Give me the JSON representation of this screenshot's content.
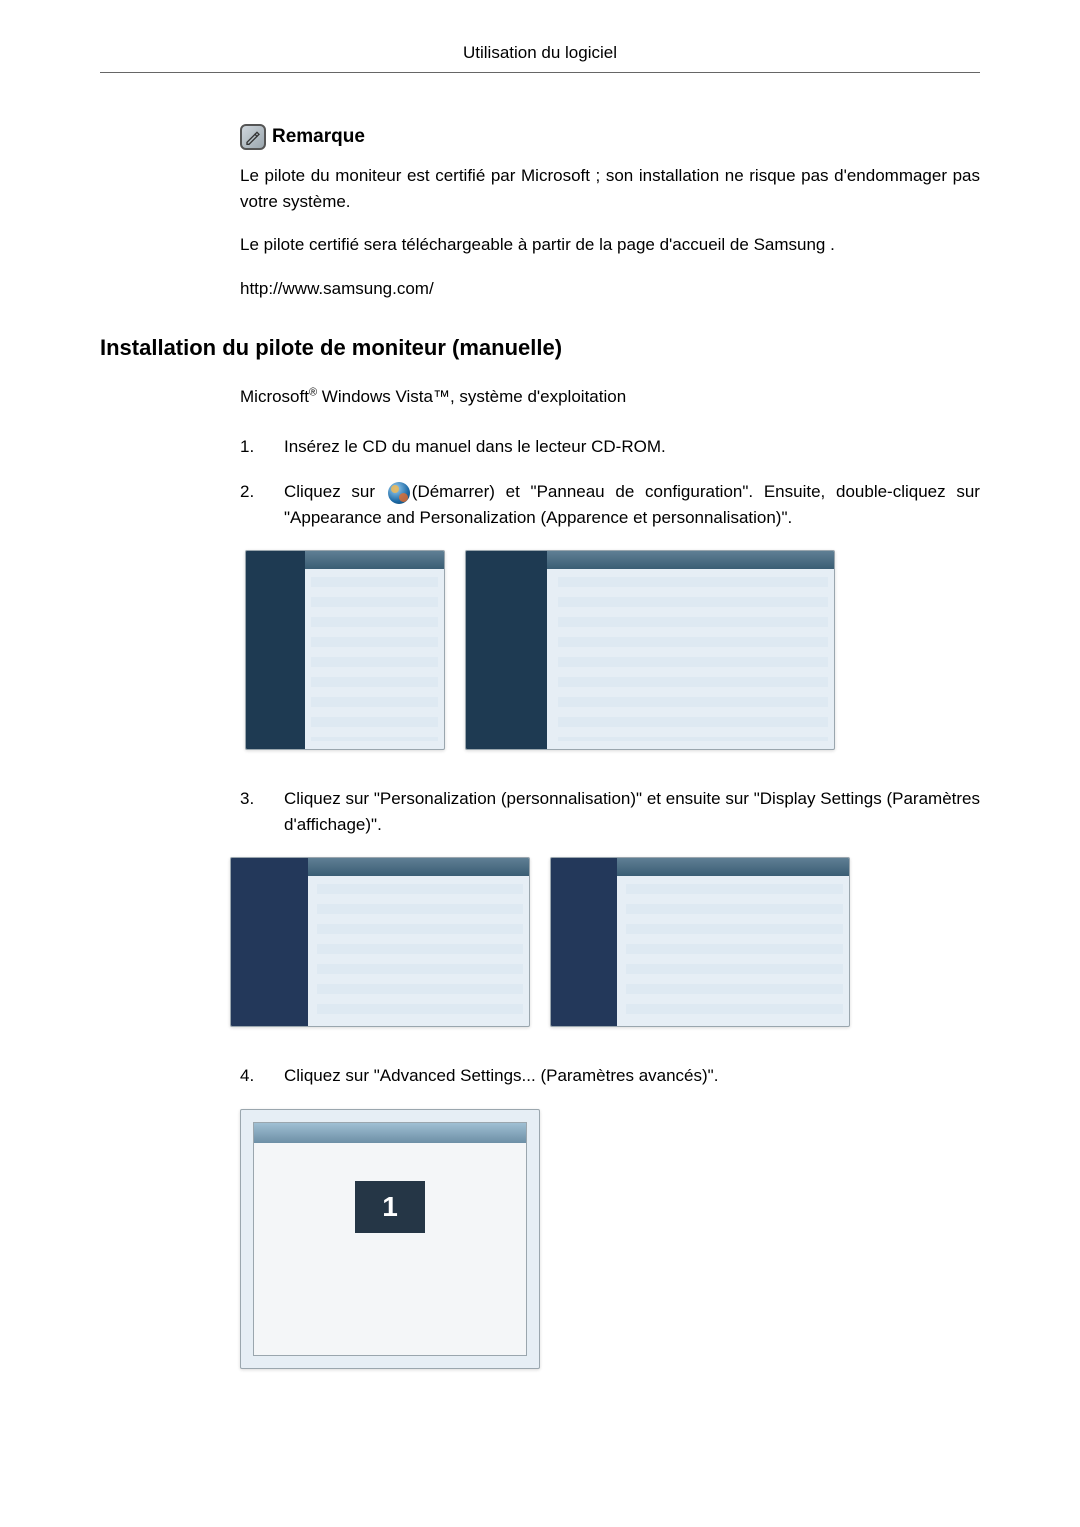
{
  "header": {
    "title": "Utilisation du logiciel"
  },
  "remark": {
    "label": "Remarque",
    "p1": "Le pilote du moniteur est certifié par Microsoft ; son installation ne risque pas d'endommager pas votre système.",
    "p2": "Le pilote certifié sera téléchargeable à partir de la page d'accueil de Samsung .",
    "url": "http://www.samsung.com/"
  },
  "section": {
    "title": "Installation du pilote de moniteur (manuelle)",
    "subtitle_prefix": "Microsoft",
    "subtitle_reg": "®",
    "subtitle_mid": " Windows Vista",
    "subtitle_tm": "™",
    "subtitle_suffix": ", système d'exploitation"
  },
  "steps": {
    "s1": {
      "num": "1.",
      "text": "Insérez le CD du manuel dans le lecteur CD-ROM."
    },
    "s2": {
      "num": "2.",
      "before": "Cliquez sur",
      "after": "(Démarrer) et \"Panneau de configuration\". Ensuite, double-cliquez sur \"Appearance and Personalization (Apparence et personnalisation)\"."
    },
    "s3": {
      "num": "3.",
      "text": "Cliquez sur \"Personalization (personnalisation)\" et ensuite sur \"Display Settings (Paramètres d'affichage)\"."
    },
    "s4": {
      "num": "4.",
      "text": "Cliquez sur \"Advanced Settings... (Paramètres avancés)\"."
    }
  },
  "figure_monitor_label": "1"
}
